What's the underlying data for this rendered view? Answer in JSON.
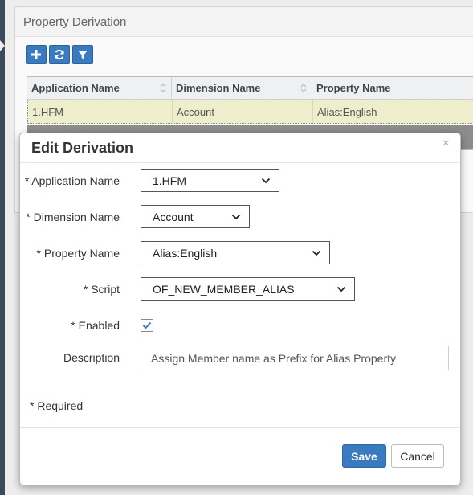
{
  "panel": {
    "title": "Property Derivation",
    "toolbar_icons": [
      "add-icon",
      "refresh-icon",
      "filter-icon"
    ]
  },
  "grid": {
    "columns": [
      "Application Name",
      "Dimension Name",
      "Property Name"
    ],
    "rows": [
      [
        "1.HFM",
        "Account",
        "Alias:English"
      ]
    ]
  },
  "modal": {
    "title": "Edit Derivation",
    "close": "×",
    "fields": {
      "application": {
        "label": "* Application Name",
        "value": "1.HFM"
      },
      "dimension": {
        "label": "* Dimension Name",
        "value": "Account"
      },
      "property": {
        "label": "* Property Name",
        "value": "Alias:English"
      },
      "script": {
        "label": "* Script",
        "value": "OF_NEW_MEMBER_ALIAS"
      },
      "enabled": {
        "label": "* Enabled",
        "checked": true
      },
      "description": {
        "label": "Description",
        "value": "Assign Member name as Prefix for Alias Property"
      }
    },
    "required_note": "* Required",
    "save_label": "Save",
    "cancel_label": "Cancel"
  },
  "colors": {
    "accent": "#3a7bbf",
    "row_selected": "#eeeecd"
  }
}
